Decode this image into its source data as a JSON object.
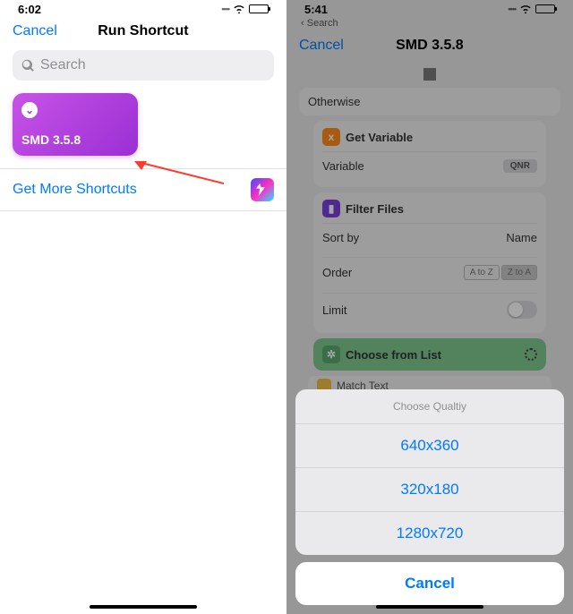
{
  "left": {
    "status_time": "6:02",
    "nav_cancel": "Cancel",
    "nav_title": "Run Shortcut",
    "search_placeholder": "Search",
    "shortcut_label": "SMD 3.5.8",
    "get_more": "Get More Shortcuts"
  },
  "right": {
    "status_time": "5:41",
    "back_hint": "Search",
    "nav_cancel": "Cancel",
    "nav_title": "SMD 3.5.8",
    "otherwise": "Otherwise",
    "get_variable": {
      "title": "Get Variable",
      "row_label": "Variable",
      "row_value": "QNR"
    },
    "filter_files": {
      "title": "Filter Files",
      "sort_by_label": "Sort by",
      "sort_by_value": "Name",
      "order_label": "Order",
      "order_opts": [
        "A to Z",
        "Z to A"
      ],
      "limit_label": "Limit"
    },
    "choose_from_list": "Choose from List",
    "match_text": "Match Text",
    "sheet": {
      "title": "Choose Qualtiy",
      "options": [
        "640x360",
        "320x180",
        "1280x720"
      ],
      "cancel": "Cancel"
    }
  }
}
